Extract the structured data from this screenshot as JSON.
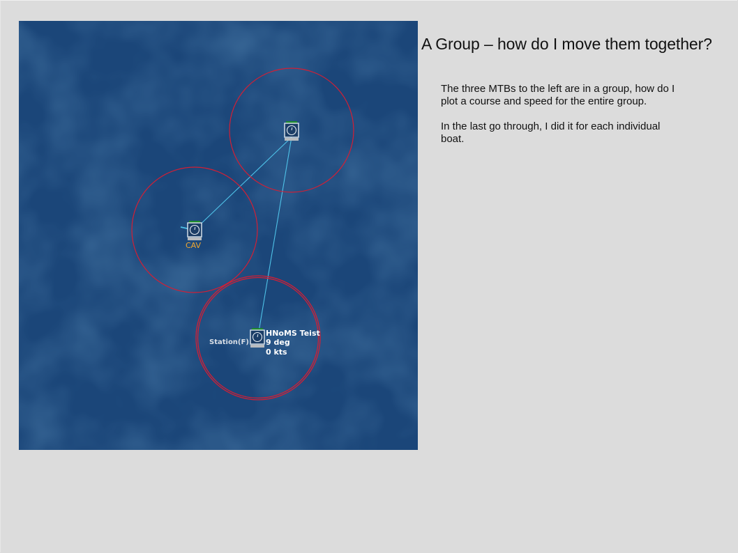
{
  "slide": {
    "title": "A Group – how do I move them together?",
    "paragraphs": [
      "The three MTBs to the left are in a group, how do I plot a course and speed for the entire group.",
      "In the last go through, I did it for each individual boat."
    ]
  },
  "map": {
    "sea_color": "#1b4679",
    "range_ring_color": "#d21f35",
    "course_line_color": "#4fc3e8",
    "units": [
      {
        "id": "north",
        "icon": "mtb-unit-icon",
        "label": ""
      },
      {
        "id": "cav",
        "icon": "mtb-unit-icon",
        "label": "CAV",
        "label_color": "#f0a830"
      },
      {
        "id": "teist",
        "icon": "mtb-unit-icon",
        "label": "HNoMS Teist",
        "heading": "9 deg",
        "speed": "0 kts",
        "station": "Station(F)"
      }
    ]
  }
}
